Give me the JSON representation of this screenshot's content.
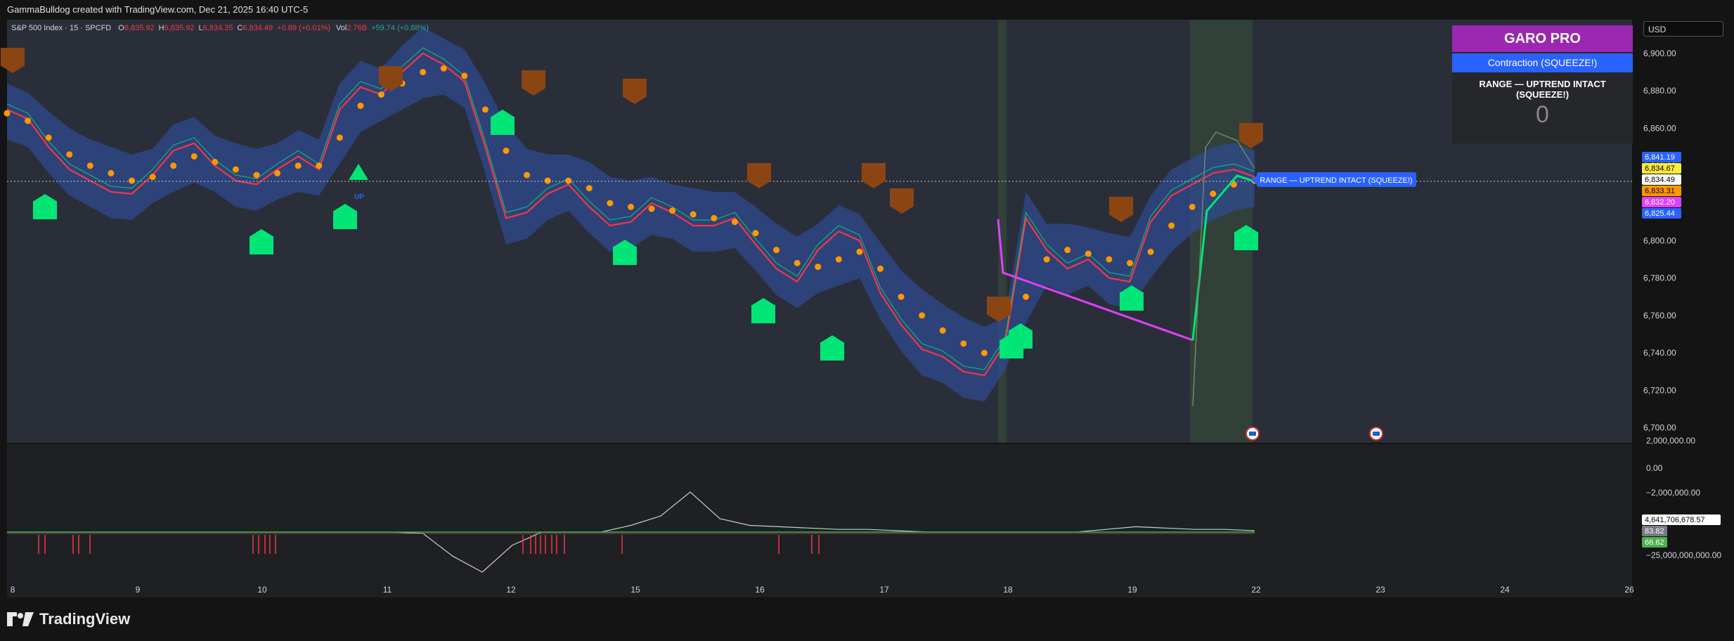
{
  "header": {
    "text": "GammaBulldog created with TradingView.com, Dec 21, 2025 16:40 UTC-5"
  },
  "legend": {
    "symbol": "S&P 500 Index · 15 · SPCFD",
    "o_label": "O",
    "o_value": "6,835.92",
    "h_label": "H",
    "h_value": "6,835.92",
    "l_label": "L",
    "l_value": "6,834.35",
    "c_label": "C",
    "c_value": "6,834.49",
    "change": "+0.89 (+0.01%)",
    "vol_label": "Vol",
    "vol_value": "2.76B",
    "vol_change": "+59.74 (+0.88%)"
  },
  "currency": "USD",
  "garo": {
    "title": "GARO PRO",
    "state": "Contraction (SQUEEZE!)",
    "regime": "RANGE — UPTREND INTACT (SQUEEZE!)",
    "count": "0"
  },
  "colors": {
    "background": "#141414",
    "pane": "#2a2e39",
    "band": "#2f4a8f",
    "trend_dots": "#ff9800",
    "buy_signal": "#00e676",
    "sell_signal": "#8b4513",
    "magenta": "#e040fb",
    "garo_title": "#9c27b0",
    "garo_state": "#2962ff"
  },
  "icons": {
    "logo": "tradingview-logo-icon",
    "buy": "buy-signal-icon",
    "sell": "sell-signal-icon",
    "event": "us-flag-event-icon"
  },
  "footer": {
    "brand": "TradingView"
  },
  "chart_data": [
    {
      "type": "line",
      "pane": "price",
      "yticks": [
        "6,900.00",
        "6,880.00",
        "6,860.00",
        "6,840.00",
        "6,820.00",
        "6,800.00",
        "6,780.00",
        "6,760.00",
        "6,740.00",
        "6,720.00",
        "6,700.00"
      ],
      "ylim": [
        6692,
        6918
      ],
      "xticks": [
        "8",
        "9",
        "10",
        "11",
        "12",
        "15",
        "16",
        "17",
        "18",
        "19",
        "22",
        "23",
        "24",
        "26"
      ],
      "series": [
        {
          "values": [
            6870,
            6865,
            6850,
            6838,
            6832,
            6826,
            6825,
            6835,
            6848,
            6852,
            6840,
            6832,
            6830,
            6838,
            6845,
            6838,
            6870,
            6882,
            6878,
            6890,
            6900,
            6894,
            6885,
            6850,
            6812,
            6815,
            6825,
            6830,
            6818,
            6808,
            6810,
            6820,
            6815,
            6808,
            6808,
            6812,
            6798,
            6785,
            6778,
            6795,
            6805,
            6800,
            6772,
            6755,
            6742,
            6738,
            6730,
            6728,
            6745,
            6812,
            6795,
            6785,
            6790,
            6780,
            6778,
            6810,
            6824,
            6830,
            6836,
            6838,
            6834
          ]
        },
        {
          "values": [
            6868,
            6864,
            6855,
            6846,
            6840,
            6836,
            6832,
            6834,
            6840,
            6845,
            6842,
            6838,
            6835,
            6836,
            6840,
            6840,
            6855,
            6872,
            6878,
            6884,
            6890,
            6892,
            6888,
            6870,
            6848,
            6835,
            6832,
            6832,
            6828,
            6820,
            6818,
            6817,
            6816,
            6814,
            6812,
            6810,
            6804,
            6795,
            6788,
            6786,
            6790,
            6794,
            6785,
            6770,
            6760,
            6752,
            6745,
            6740,
            6745,
            6770,
            6790,
            6795,
            6793,
            6790,
            6788,
            6794,
            6808,
            6818,
            6825,
            6830,
            6832
          ]
        },
        {
          "values": [
            6790,
            6800,
            6815,
            6790,
            6778
          ]
        }
      ],
      "markers": {
        "buy_count": 15,
        "sell_count": 11
      },
      "price_labels": [
        "6,841.19",
        "6,834.67",
        "6,834.49",
        "6,833.31",
        "6,832.20",
        "6,825.44"
      ],
      "annotation": "RANGE — UPTREND INTACT (SQUEEZE!)",
      "pointer_label": "UP"
    },
    {
      "type": "line",
      "pane": "oscillator",
      "yticks": [
        "2,000,000.00",
        "0.00",
        "−2,000,000.00",
        "−25,000,000,000.00"
      ],
      "value_labels": [
        "4,641,706,678.57",
        "83.82",
        "66.62"
      ],
      "series": [
        {
          "values": [
            0,
            0,
            0,
            0,
            0,
            0,
            0,
            0,
            0,
            0,
            0,
            0,
            0,
            0,
            -1,
            -18,
            -30,
            -10,
            0,
            0,
            0,
            5,
            12,
            30,
            10,
            5,
            4,
            3,
            2,
            2,
            1,
            0,
            0,
            0,
            0,
            0,
            0,
            2,
            4,
            3,
            2,
            2,
            1
          ]
        }
      ]
    }
  ]
}
